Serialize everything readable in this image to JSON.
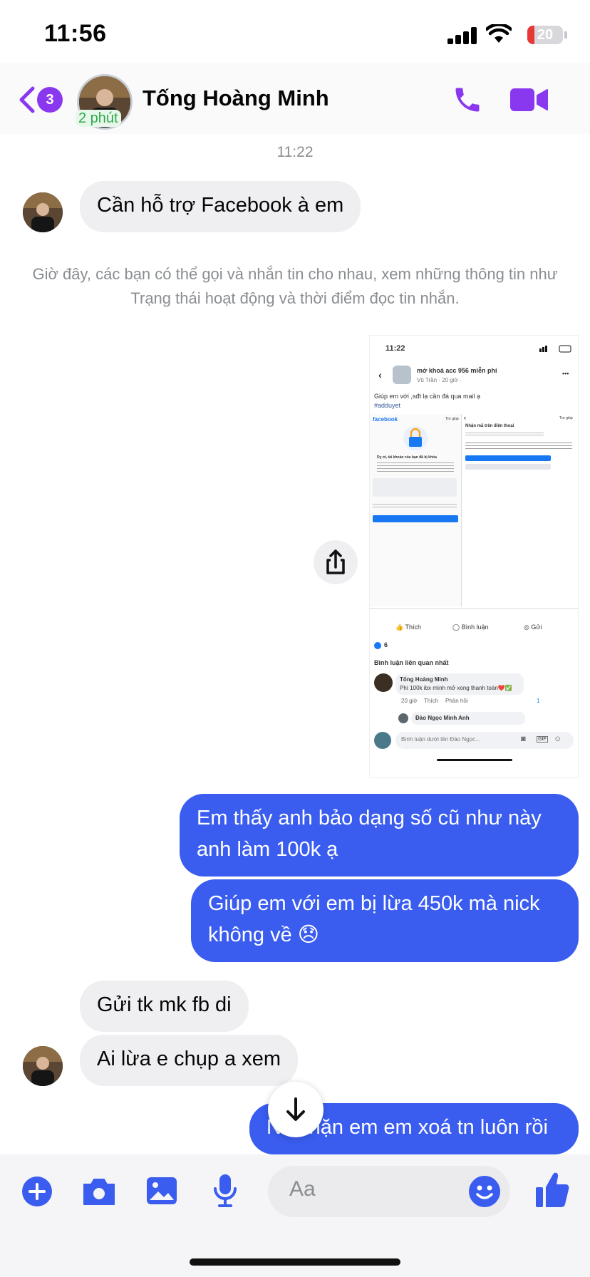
{
  "status_bar": {
    "time": "11:56",
    "battery": "20",
    "battery_level": 0.2
  },
  "header": {
    "back_badge": "3",
    "contact_name": "Tống Hoàng Minh",
    "active_status": "2 phút"
  },
  "messages": {
    "timestamp": "11:22",
    "m1": "Cần hỗ trợ Facebook à em",
    "notice": "Giờ đây, các bạn có thể gọi và nhắn tin cho nhau, xem những thông tin như Trạng thái hoạt động và thời điểm đọc tin nhắn.",
    "m2": "Em thấy anh bảo dạng số cũ như này anh làm 100k ạ",
    "m3": "Giúp em với em bị lừa 450k mà nick không về 😞",
    "m4": "Gửi tk mk fb di",
    "m5": "Ai lừa e chụp a xem",
    "m6": "Nó chặn em em xoá tn luôn rồi"
  },
  "shared_image": {
    "time": "11:22",
    "post_title": "mở khoá acc 956 miễn phí",
    "post_meta": "Vũ Trần · 20 giờ ·",
    "post_text": "Giúp em với ,sđt lạ cần đá qua mail ạ",
    "hashtag": "#adduyet",
    "fb_logo": "facebook",
    "help": "Trợ giúp",
    "locked_title": "Dỵ ơi, tài khoản của bạn đã bị khóa",
    "phone_title": "Nhận mã trên điện thoại",
    "like": "Thích",
    "comment": "Bình luận",
    "send": "Gửi",
    "reaction_count": "6",
    "relevant": "Bình luận liên quan nhất",
    "commenter": "Tống Hoàng Minh",
    "comment_text": "Phí 100k ibx mình mở xong thanh toán❤️✅",
    "comment_time": "20 giờ",
    "comment_like": "Thích",
    "comment_reply": "Phản hồi",
    "comment_likes": "1",
    "reply_name": "Đào Ngọc Minh Anh",
    "reply_placeholder": "Bình luận dưới tên Đào Ngọc..."
  },
  "composer": {
    "placeholder": "Aa"
  },
  "colors": {
    "accent": "#8a37f0",
    "outgoing": "#3a5df0",
    "incoming": "#efeff1"
  }
}
